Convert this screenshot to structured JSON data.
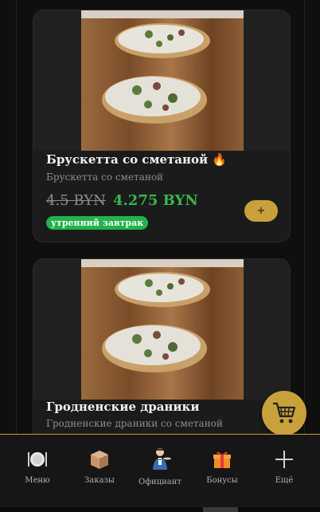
{
  "products": [
    {
      "title": "Брускетта со сметаной 🔥",
      "subtitle": "Брускетта со сметаной",
      "old_price": "4.5 BYN",
      "new_price": "4.275 BYN",
      "tag": "утренний завтрак",
      "add_label": "+"
    },
    {
      "title": "Гродненские драники",
      "subtitle": "Гродненские драники со сметаной"
    }
  ],
  "nav": {
    "items": [
      {
        "label": "Меню",
        "icon": "plate-cutlery-icon"
      },
      {
        "label": "Заказы",
        "icon": "box-icon"
      },
      {
        "label": "Официант",
        "icon": "waiter-icon"
      },
      {
        "label": "Бонусы",
        "icon": "gift-icon"
      },
      {
        "label": "Ещё",
        "icon": "plus-icon"
      }
    ]
  },
  "colors": {
    "accent": "#c9a13a",
    "price_green": "#39b54a",
    "tag_green": "#22b24c",
    "background": "#0f0f0f",
    "card": "#1b1b1b"
  }
}
